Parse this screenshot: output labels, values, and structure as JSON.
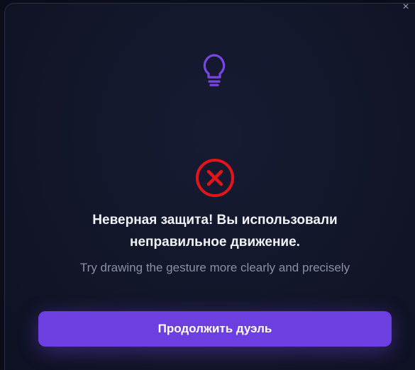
{
  "dialog": {
    "close_label": "×",
    "title": "Неверная защита! Вы использовали неправильное движение.",
    "subtitle": "Try drawing the gesture more clearly and precisely",
    "continue_label": "Продолжить дуэль"
  },
  "icons": {
    "hint": "lightbulb-icon",
    "error": "error-x-circle-icon",
    "close": "close-icon"
  },
  "colors": {
    "accent": "#6e3fe0",
    "bulb": "#7a45e6",
    "error": "#e3151b",
    "background": "#121628"
  }
}
